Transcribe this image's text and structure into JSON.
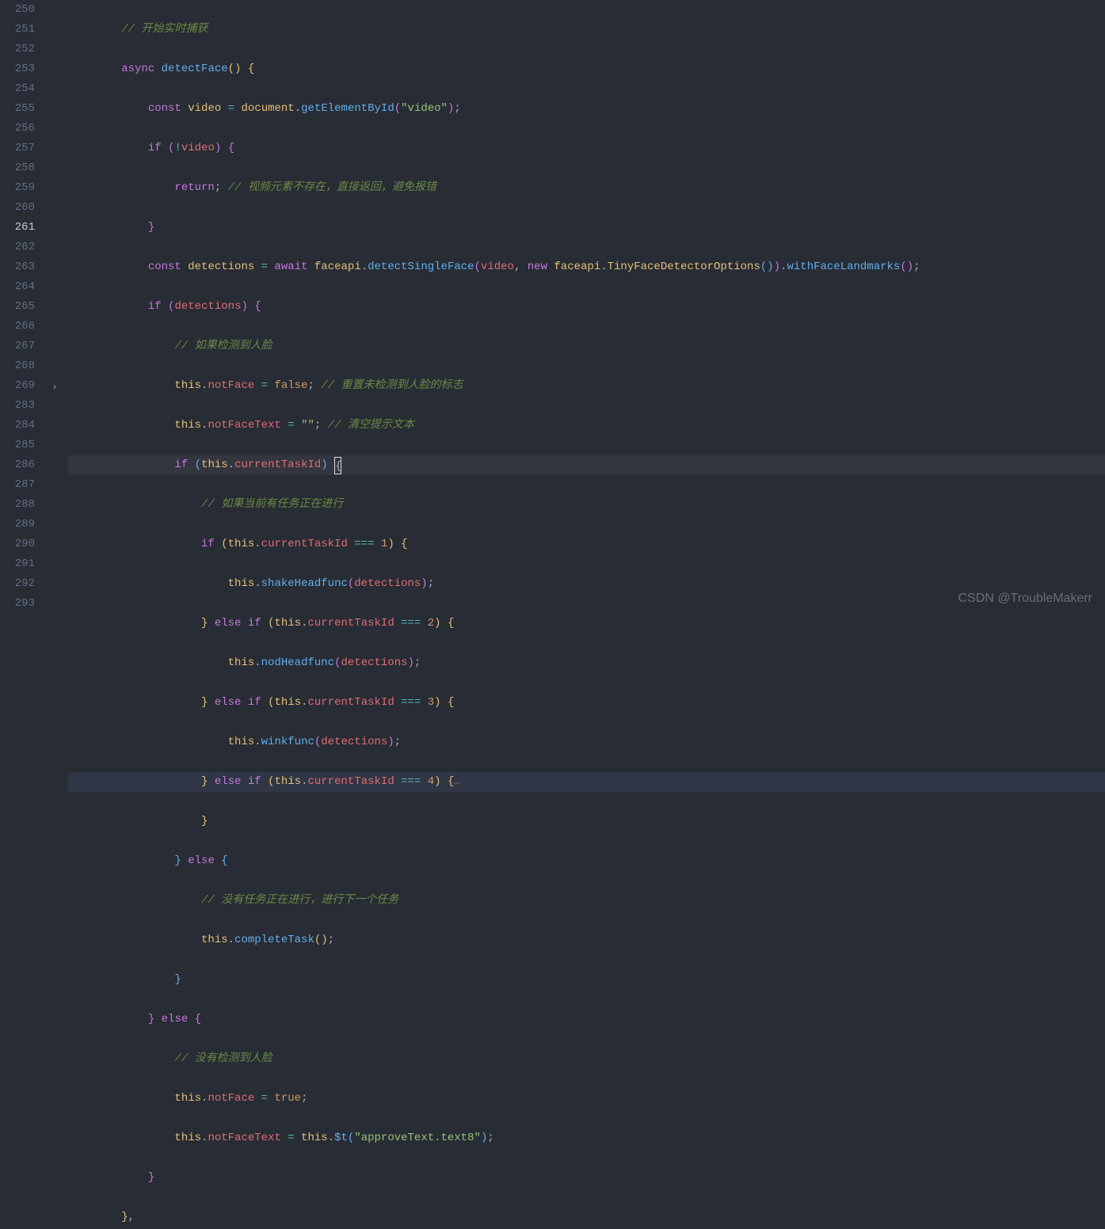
{
  "line_numbers": [
    "250",
    "251",
    "252",
    "253",
    "254",
    "255",
    "256",
    "257",
    "258",
    "259",
    "260",
    "261",
    "262",
    "263",
    "264",
    "265",
    "266",
    "267",
    "268",
    "269",
    "283",
    "284",
    "285",
    "286",
    "287",
    "288",
    "289",
    "290",
    "291",
    "292",
    "293"
  ],
  "active_line_index": 11,
  "highlighted_line_index": 19,
  "fold_marker_index": 19,
  "watermark": "CSDN @TroubleMakerr",
  "code": {
    "l250_comment": "// 开始实时捕获",
    "l251_async": "async",
    "l251_fn": "detectFace",
    "l252_const": "const",
    "l252_video": "video",
    "l252_doc": "document",
    "l252_getel": "getElementById",
    "l252_str": "\"video\"",
    "l253_if": "if",
    "l253_video": "video",
    "l254_return": "return",
    "l254_comment": "// 视频元素不存在，直接返回，避免报错",
    "l256_const": "const",
    "l256_det": "detections",
    "l256_await": "await",
    "l256_faceapi": "faceapi",
    "l256_dsf": "detectSingleFace",
    "l256_video": "video",
    "l256_new": "new",
    "l256_faceapi2": "faceapi",
    "l256_tiny": "TinyFaceDetectorOptions",
    "l256_wfl": "withFaceLandmarks",
    "l257_if": "if",
    "l257_det": "detections",
    "l258_comment": "// 如果检测到人脸",
    "l259_this": "this",
    "l259_nf": "notFace",
    "l259_false": "false",
    "l259_comment": "// 重置未检测到人脸的标志",
    "l260_this": "this",
    "l260_nft": "notFaceText",
    "l260_str": "\"\"",
    "l260_comment": "// 清空提示文本",
    "l261_if": "if",
    "l261_this": "this",
    "l261_cti": "currentTaskId",
    "l262_comment": "// 如果当前有任务正在进行",
    "l263_if": "if",
    "l263_this": "this",
    "l263_cti": "currentTaskId",
    "l263_eq": "===",
    "l263_n": "1",
    "l264_this": "this",
    "l264_fn": "shakeHeadfunc",
    "l264_arg": "detections",
    "l265_else": "else",
    "l265_if": "if",
    "l265_this": "this",
    "l265_cti": "currentTaskId",
    "l265_eq": "===",
    "l265_n": "2",
    "l266_this": "this",
    "l266_fn": "nodHeadfunc",
    "l266_arg": "detections",
    "l267_else": "else",
    "l267_if": "if",
    "l267_this": "this",
    "l267_cti": "currentTaskId",
    "l267_eq": "===",
    "l267_n": "3",
    "l268_this": "this",
    "l268_fn": "winkfunc",
    "l268_arg": "detections",
    "l269_else": "else",
    "l269_if": "if",
    "l269_this": "this",
    "l269_cti": "currentTaskId",
    "l269_eq": "===",
    "l269_n": "4",
    "l269_fold": "…",
    "l284_else": "else",
    "l285_comment": "// 没有任务正在进行，进行下一个任务",
    "l286_this": "this",
    "l286_fn": "completeTask",
    "l288_else": "else",
    "l289_comment": "// 没有检测到人脸",
    "l290_this": "this",
    "l290_nf": "notFace",
    "l290_true": "true",
    "l291_this": "this",
    "l291_nft": "notFaceText",
    "l291_this2": "this",
    "l291_dt": "$t",
    "l291_str": "\"approveText.text8\""
  }
}
